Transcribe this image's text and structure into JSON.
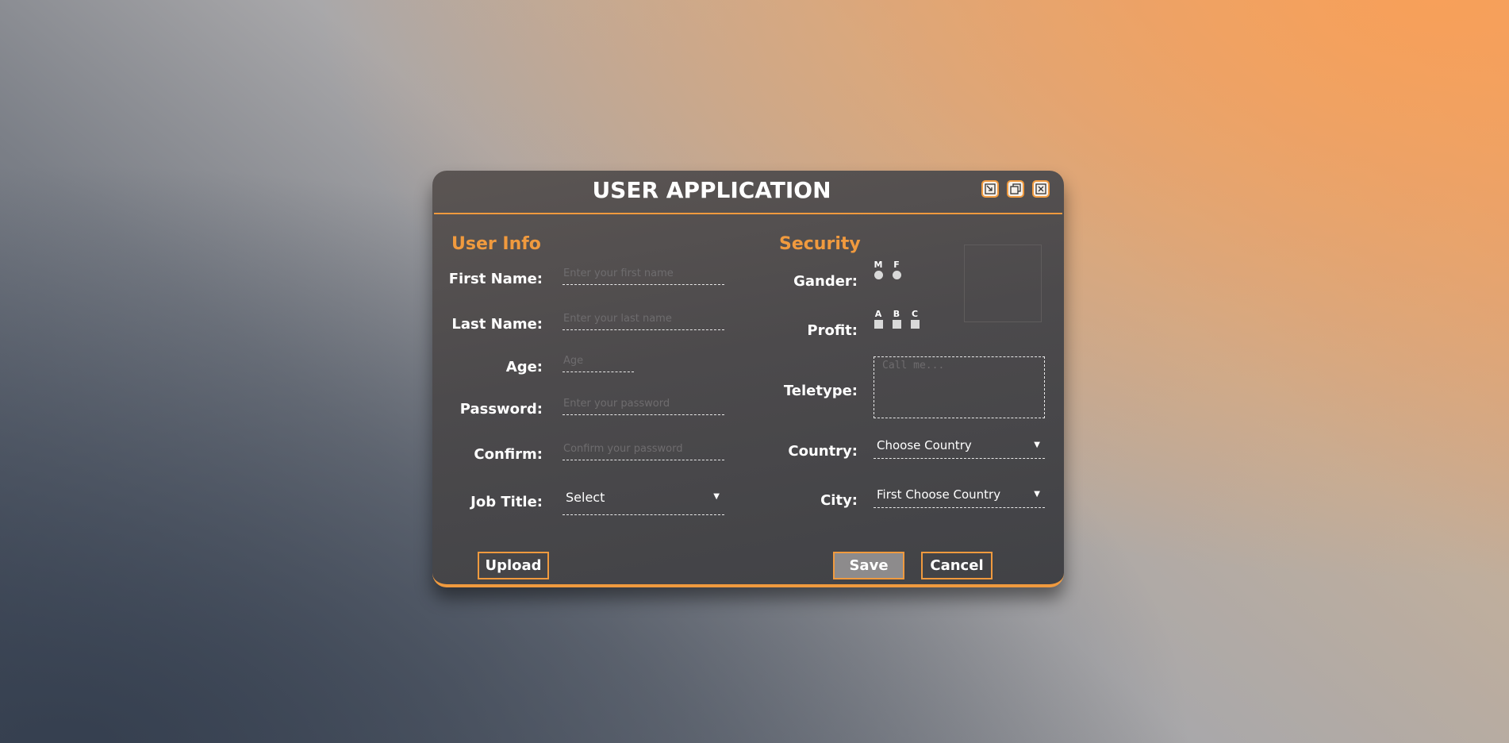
{
  "dialog": {
    "title": "USER APPLICATION",
    "window_buttons": [
      "minimize-icon",
      "restore-icon",
      "close-icon"
    ]
  },
  "user_info": {
    "section_title": "User Info",
    "first_name": {
      "label": "First Name:",
      "placeholder": "Enter your first name",
      "value": ""
    },
    "last_name": {
      "label": "Last Name:",
      "placeholder": "Enter your last name",
      "value": ""
    },
    "age": {
      "label": "Age:",
      "placeholder": "Age",
      "value": ""
    },
    "password": {
      "label": "Password:",
      "placeholder": "Enter your password",
      "value": ""
    },
    "confirm": {
      "label": "Confirm:",
      "placeholder": "Confirm your password",
      "value": ""
    },
    "job_title": {
      "label": "Job Title:",
      "selected": "Select"
    }
  },
  "security": {
    "section_title": "Security",
    "gender": {
      "label": "Gander:",
      "options": [
        "M",
        "F"
      ]
    },
    "profit": {
      "label": "Profit:",
      "options": [
        "A",
        "B",
        "C"
      ]
    },
    "teletype": {
      "label": "Teletype:",
      "placeholder": "Call me..."
    },
    "country": {
      "label": "Country:",
      "selected": "Choose Country"
    },
    "city": {
      "label": "City:",
      "selected": "First Choose Country"
    }
  },
  "actions": {
    "upload": "Upload",
    "save": "Save",
    "cancel": "Cancel"
  },
  "colors": {
    "accent": "#f09a3e",
    "panel": "#4c4a4c",
    "text": "#ffffff"
  }
}
